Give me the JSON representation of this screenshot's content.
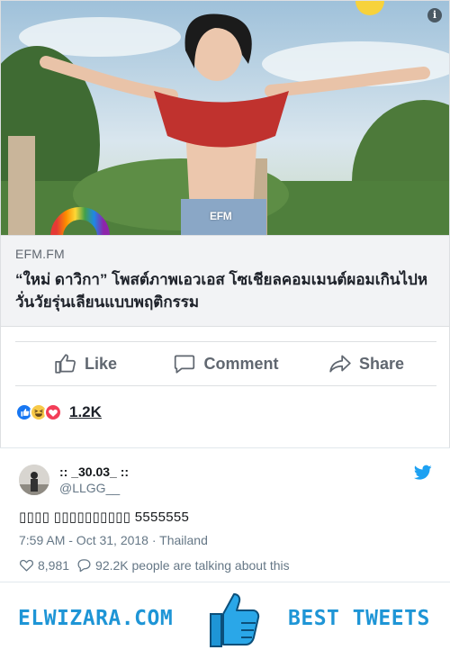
{
  "link_card": {
    "image_watermark": "EFM",
    "info_icon": "info-icon",
    "domain": "EFM.FM",
    "title": "“ใหม่ ดาวิกา” โพสต์ภาพเอวเอส โซเชียลคอมเมนต์ผอมเกินไปหวั่นวัยรุ่นเลียนแบบพฤติกรรม"
  },
  "actions": {
    "like_label": "Like",
    "comment_label": "Comment",
    "share_label": "Share"
  },
  "reactions": {
    "count": "1.2K",
    "icons": [
      "like-icon",
      "haha-icon",
      "love-icon"
    ]
  },
  "tweet": {
    "display_name": ":: _30.03_ ::",
    "handle": "@LLGG__",
    "text": "▯▯▯▯ ▯▯▯▯▯▯▯▯▯▯ 5555555",
    "timestamp": "7:59 AM - Oct 31, 2018 · Thailand",
    "likes": "8,981",
    "talking": "92.2K people are talking about this"
  },
  "banner": {
    "left_text": "ELWIZARA.COM",
    "right_text": "BEST TWEETS"
  },
  "colors": {
    "fb_gray": "#606770",
    "twitter_blue": "#1da1f2",
    "banner_blue": "#1e95d6",
    "love_red": "#f33e58",
    "like_blue": "#1877f2"
  }
}
